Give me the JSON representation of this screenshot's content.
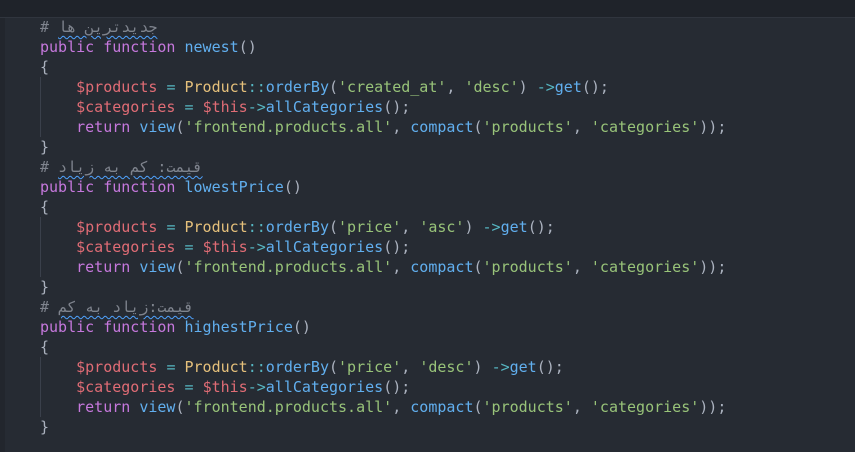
{
  "colors": {
    "background": "#262b33",
    "keyword": "#c678dd",
    "function": "#61afef",
    "variable": "#e06c75",
    "string": "#98c379",
    "operator": "#56b6c2",
    "class": "#e5c07b",
    "comment": "#7f848e",
    "spellcheck_underline": "#4fa3ff"
  },
  "code": {
    "blocks": [
      {
        "comment_hash": "#",
        "comment_text": "جدیدترین ها",
        "kw_public": "public",
        "kw_function": "function",
        "name": "newest",
        "params": "()",
        "open_brace": "{",
        "line1": {
          "var": "$products",
          "eq": "=",
          "cls": "Product",
          "sep": "::",
          "method": "orderBy",
          "paren_open": "(",
          "arg1": "'created_at'",
          "comma": ",",
          "arg2": "'desc'",
          "paren_close": ")",
          "arrow": "->",
          "get": "get",
          "end": "();"
        },
        "line2": {
          "var": "$categories",
          "eq": "=",
          "this": "$this",
          "arrow": "->",
          "method": "allCategories",
          "end": "();"
        },
        "line3": {
          "kw_return": "return",
          "view": "view",
          "paren_open": "(",
          "view_name": "'frontend.products.all'",
          "comma1": ",",
          "compact": "compact",
          "paren_open2": "(",
          "arg1": "'products'",
          "comma2": ",",
          "arg2": "'categories'",
          "end": "));"
        },
        "close_brace": "}"
      },
      {
        "comment_hash": "#",
        "comment_text": "قیمت: کم به زیاد",
        "kw_public": "public",
        "kw_function": "function",
        "name": "lowestPrice",
        "params": "()",
        "open_brace": "{",
        "line1": {
          "var": "$products",
          "eq": "=",
          "cls": "Product",
          "sep": "::",
          "method": "orderBy",
          "paren_open": "(",
          "arg1": "'price'",
          "comma": ",",
          "arg2": "'asc'",
          "paren_close": ")",
          "arrow": "->",
          "get": "get",
          "end": "();"
        },
        "line2": {
          "var": "$categories",
          "eq": "=",
          "this": "$this",
          "arrow": "->",
          "method": "allCategories",
          "end": "();"
        },
        "line3": {
          "kw_return": "return",
          "view": "view",
          "paren_open": "(",
          "view_name": "'frontend.products.all'",
          "comma1": ",",
          "compact": "compact",
          "paren_open2": "(",
          "arg1": "'products'",
          "comma2": ",",
          "arg2": "'categories'",
          "end": "));"
        },
        "close_brace": "}"
      },
      {
        "comment_hash": "#",
        "comment_text": "قیمت:زیاد به کم",
        "kw_public": "public",
        "kw_function": "function",
        "name": "highestPrice",
        "params": "()",
        "open_brace": "{",
        "line1": {
          "var": "$products",
          "eq": "=",
          "cls": "Product",
          "sep": "::",
          "method": "orderBy",
          "paren_open": "(",
          "arg1": "'price'",
          "comma": ",",
          "arg2": "'desc'",
          "paren_close": ")",
          "arrow": "->",
          "get": "get",
          "end": "();"
        },
        "line2": {
          "var": "$categories",
          "eq": "=",
          "this": "$this",
          "arrow": "->",
          "method": "allCategories",
          "end": "();"
        },
        "line3": {
          "kw_return": "return",
          "view": "view",
          "paren_open": "(",
          "view_name": "'frontend.products.all'",
          "comma1": ",",
          "compact": "compact",
          "paren_open2": "(",
          "arg1": "'products'",
          "comma2": ",",
          "arg2": "'categories'",
          "end": "));"
        },
        "close_brace": "}"
      }
    ]
  }
}
